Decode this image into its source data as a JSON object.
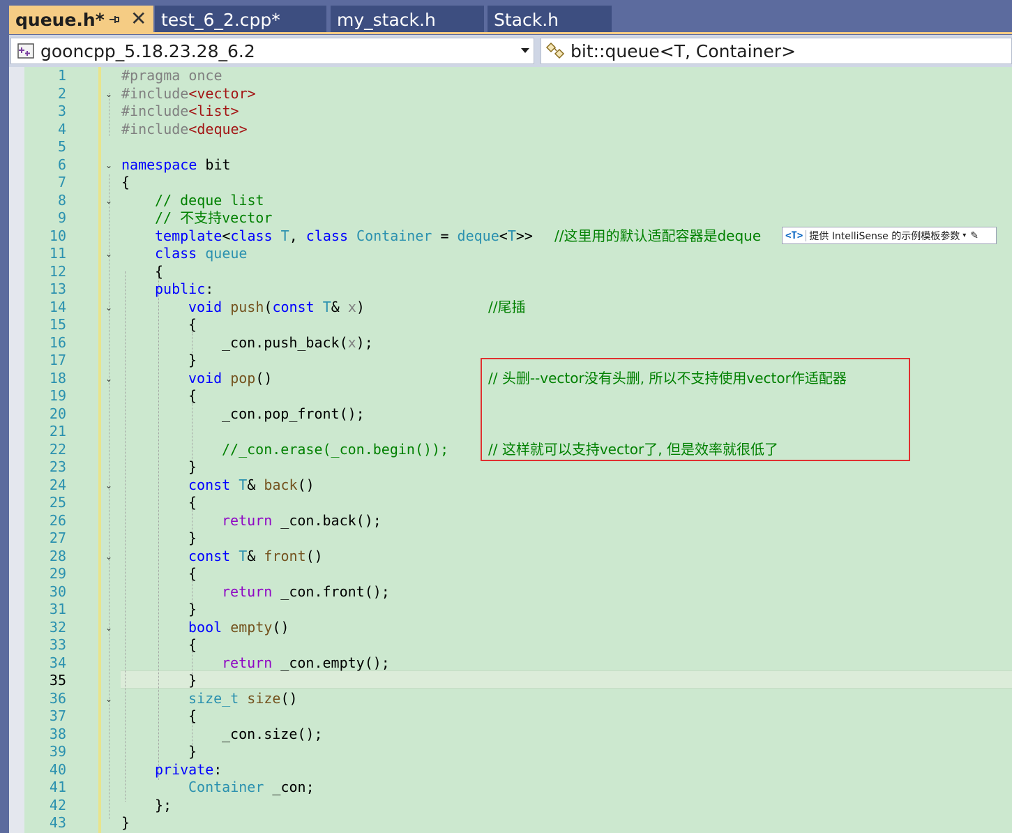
{
  "tabs": [
    {
      "label": "queue.h*",
      "active": true
    },
    {
      "label": "test_6_2.cpp*",
      "active": false
    },
    {
      "label": "my_stack.h",
      "active": false
    },
    {
      "label": "Stack.h",
      "active": false
    }
  ],
  "navbar": {
    "project": "gooncpp_5.18.23.28_6.2",
    "scope": "bit::queue<T, Container>"
  },
  "intellisense_hint": {
    "badge": "<T>",
    "text": "提供 IntelliSense 的示例模板参数"
  },
  "current_line": 35,
  "colors": {
    "editor_bg": "#cce8cf",
    "tab_active": "#f5cc84",
    "tab_inactive": "#3d4e80",
    "highlight_box": "#e03030"
  },
  "lines": {
    "n1": "1",
    "n2": "2",
    "n3": "3",
    "n4": "4",
    "n5": "5",
    "n6": "6",
    "n7": "7",
    "n8": "8",
    "n9": "9",
    "n10": "10",
    "n11": "11",
    "n12": "12",
    "n13": "13",
    "n14": "14",
    "n15": "15",
    "n16": "16",
    "n17": "17",
    "n18": "18",
    "n19": "19",
    "n20": "20",
    "n21": "21",
    "n22": "22",
    "n23": "23",
    "n24": "24",
    "n25": "25",
    "n26": "26",
    "n27": "27",
    "n28": "28",
    "n29": "29",
    "n30": "30",
    "n31": "31",
    "n32": "32",
    "n33": "33",
    "n34": "34",
    "n35": "35",
    "n36": "36",
    "n37": "37",
    "n38": "38",
    "n39": "39",
    "n40": "40",
    "n41": "41",
    "n42": "42",
    "n43": "43"
  },
  "code": {
    "l1_a": "#pragma once",
    "l2_a": "#include",
    "l2_b": "<vector>",
    "l3_a": "#include",
    "l3_b": "<list>",
    "l4_a": "#include",
    "l4_b": "<deque>",
    "l6_a": "namespace",
    "l6_b": " bit",
    "l7": "{",
    "l8": "// deque list",
    "l9": "// 不支持vector",
    "l10_a": "template",
    "l10_b": "<",
    "l10_c": "class",
    "l10_d": " T",
    "l10_e": ", ",
    "l10_f": "class",
    "l10_g": " Container",
    "l10_h": " = ",
    "l10_i": "deque",
    "l10_j": "<",
    "l10_k": "T",
    "l10_l": ">>",
    "l10_cmt": "//这里用的默认适配容器是deque",
    "l11_a": "class",
    "l11_b": " queue",
    "l12": "{",
    "l13_a": "public",
    "l13_b": ":",
    "l14_a": "void",
    "l14_b": " push",
    "l14_c": "(",
    "l14_d": "const",
    "l14_e": " T",
    "l14_f": "& ",
    "l14_g": "x",
    "l14_h": ")",
    "l14_cmt": "//尾插",
    "l15": "{",
    "l16_a": "_con.push_back(",
    "l16_b": "x",
    "l16_c": ");",
    "l17": "}",
    "l18_a": "void",
    "l18_b": " pop",
    "l18_c": "()",
    "l18_cmt": "// 头删--vector没有头删, 所以不支持使用vector作适配器",
    "l19": "{",
    "l20": "_con.pop_front();",
    "l22": "//_con.erase(_con.begin());",
    "l22_cmt": "// 这样就可以支持vector了, 但是效率就很低了",
    "l23": "}",
    "l24_a": "const",
    "l24_b": " T",
    "l24_c": "& ",
    "l24_d": "back",
    "l24_e": "()",
    "l25": "{",
    "l26_a": "return",
    "l26_b": " _con.back();",
    "l27": "}",
    "l28_a": "const",
    "l28_b": " T",
    "l28_c": "& ",
    "l28_d": "front",
    "l28_e": "()",
    "l29": "{",
    "l30_a": "return",
    "l30_b": " _con.front();",
    "l31": "}",
    "l32_a": "bool",
    "l32_b": " empty",
    "l32_c": "()",
    "l33": "{",
    "l34_a": "return",
    "l34_b": " _con.empty();",
    "l35": "}",
    "l36_a": "size_t",
    "l36_b": " size",
    "l36_c": "()",
    "l37": "{",
    "l38": "_con.size();",
    "l39": "}",
    "l40_a": "private",
    "l40_b": ":",
    "l41_a": "Container",
    "l41_b": " _con;",
    "l42": "};",
    "l43": "}"
  }
}
